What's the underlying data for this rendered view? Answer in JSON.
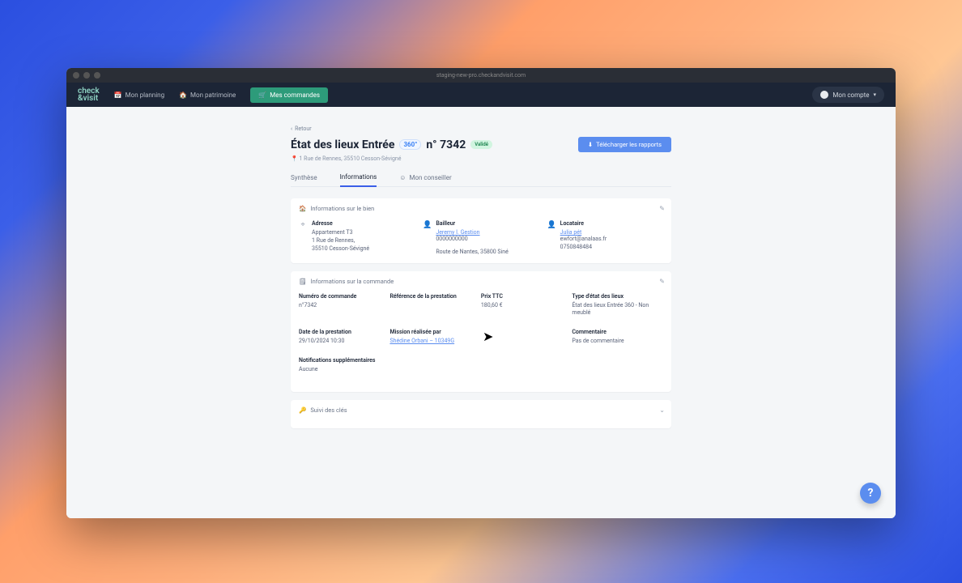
{
  "browser": {
    "url": "staging-new-pro.checkandvisit.com"
  },
  "nav": {
    "logo": "check\n&visit",
    "items": [
      {
        "icon": "📅",
        "label": "Mon planning"
      },
      {
        "icon": "🏠",
        "label": "Mon patrimoine"
      },
      {
        "icon": "🛒",
        "label": "Mes commandes"
      }
    ],
    "account_label": "Mon compte"
  },
  "page": {
    "back": "Retour",
    "title": "État des lieux Entrée",
    "badge360": "360°",
    "number_prefix": "n°",
    "number": "7342",
    "status": "Validé",
    "download_btn": "Télécharger les rapports",
    "breadcrumb": "1 Rue de Rennes, 35510 Cesson-Sévigné",
    "tabs": [
      {
        "label": "Synthèse"
      },
      {
        "label": "Informations"
      },
      {
        "label": "Mon conseiller",
        "icon": "☺"
      }
    ]
  },
  "bien": {
    "section_title": "Informations sur le bien",
    "adresse": {
      "label": "Adresse",
      "line1": "Appartement T3",
      "line2": "1 Rue de Rennes,",
      "line3": "35510 Cesson-Sévigné"
    },
    "bailleur": {
      "label": "Bailleur",
      "name": "Jeremy I. Gestion",
      "phone": "0000000000",
      "addr": "Route de Nantes, 35800 Siné"
    },
    "locataire": {
      "label": "Locataire",
      "name": "Julia pét",
      "email": "ewfort@analaas.fr",
      "phone": "0750848484"
    }
  },
  "commande": {
    "section_title": "Informations sur la commande",
    "numero": {
      "label": "Numéro de commande",
      "value": "n°7342"
    },
    "reference": {
      "label": "Référence de la prestation",
      "value": ""
    },
    "prix": {
      "label": "Prix TTC",
      "value": "180,60 €"
    },
    "type": {
      "label": "Type d'état des lieux",
      "value": "État des lieux Entrée 360 - Non meublé"
    },
    "date": {
      "label": "Date de la prestation",
      "value": "29/10/2024 10:30"
    },
    "mission": {
      "label": "Mission réalisée par",
      "value": "Shédine Orbani – 10349G"
    },
    "comment": {
      "label": "Commentaire",
      "value": "Pas de commentaire"
    },
    "notif": {
      "label": "Notifications supplémentaires",
      "value": "Aucune"
    }
  },
  "suivi": {
    "section_title": "Suivi des clés"
  }
}
